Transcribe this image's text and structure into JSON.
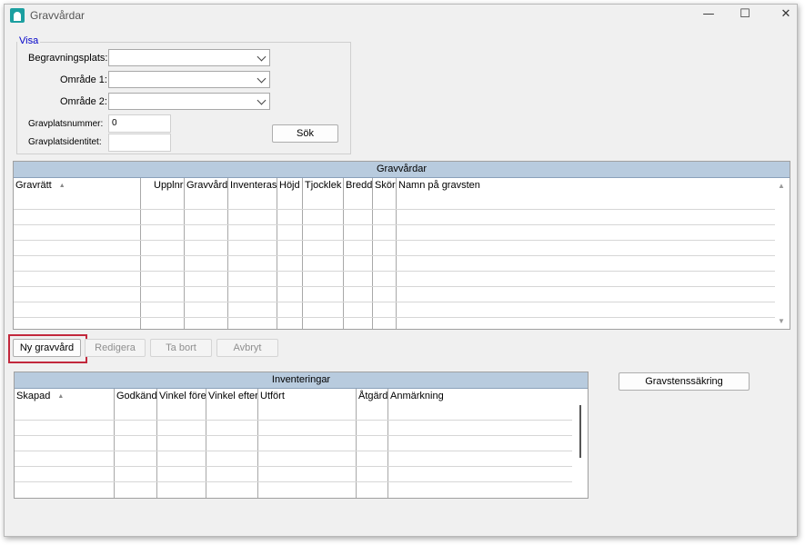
{
  "window": {
    "title": "Gravvårdar",
    "minimize": "—",
    "maximize": "☐",
    "close": "✕"
  },
  "filter": {
    "legend": "Visa",
    "begravningsplats_label": "Begravningsplats:",
    "omrade1_label": "Område 1:",
    "omrade2_label": "Område 2:",
    "gravplatsnummer_label": "Gravplatsnummer:",
    "gravplatsnummer_value": "0",
    "gravplatsidentitet_label": "Gravplatsidentitet:",
    "gravplatsidentitet_value": "",
    "search_button": "Sök"
  },
  "gravvardar_grid": {
    "title": "Gravvårdar",
    "columns": [
      "Gravrätt",
      "Upplnr",
      "Gravvård",
      "Inventeras",
      "Höjd",
      "Tjocklek",
      "Bredd",
      "Skör",
      "Namn på gravsten"
    ],
    "sorted_column": "Gravrätt"
  },
  "actions": {
    "new": "Ny gravvård",
    "edit": "Redigera",
    "delete": "Ta bort",
    "cancel": "Avbryt",
    "insurance": "Gravstenssäkring"
  },
  "inventeringar_grid": {
    "title": "Inventeringar",
    "columns": [
      "Skapad",
      "Godkänd",
      "Vinkel före",
      "Vinkel efter",
      "Utfört",
      "Åtgärd",
      "Anmärkning"
    ],
    "sorted_column": "Skapad"
  },
  "icons": {
    "sort": "sort-ascending-icon",
    "scroll_up": "scroll-up-arrow-icon",
    "scroll_down": "scroll-down-arrow-icon",
    "app": "gravestone-app-icon"
  }
}
